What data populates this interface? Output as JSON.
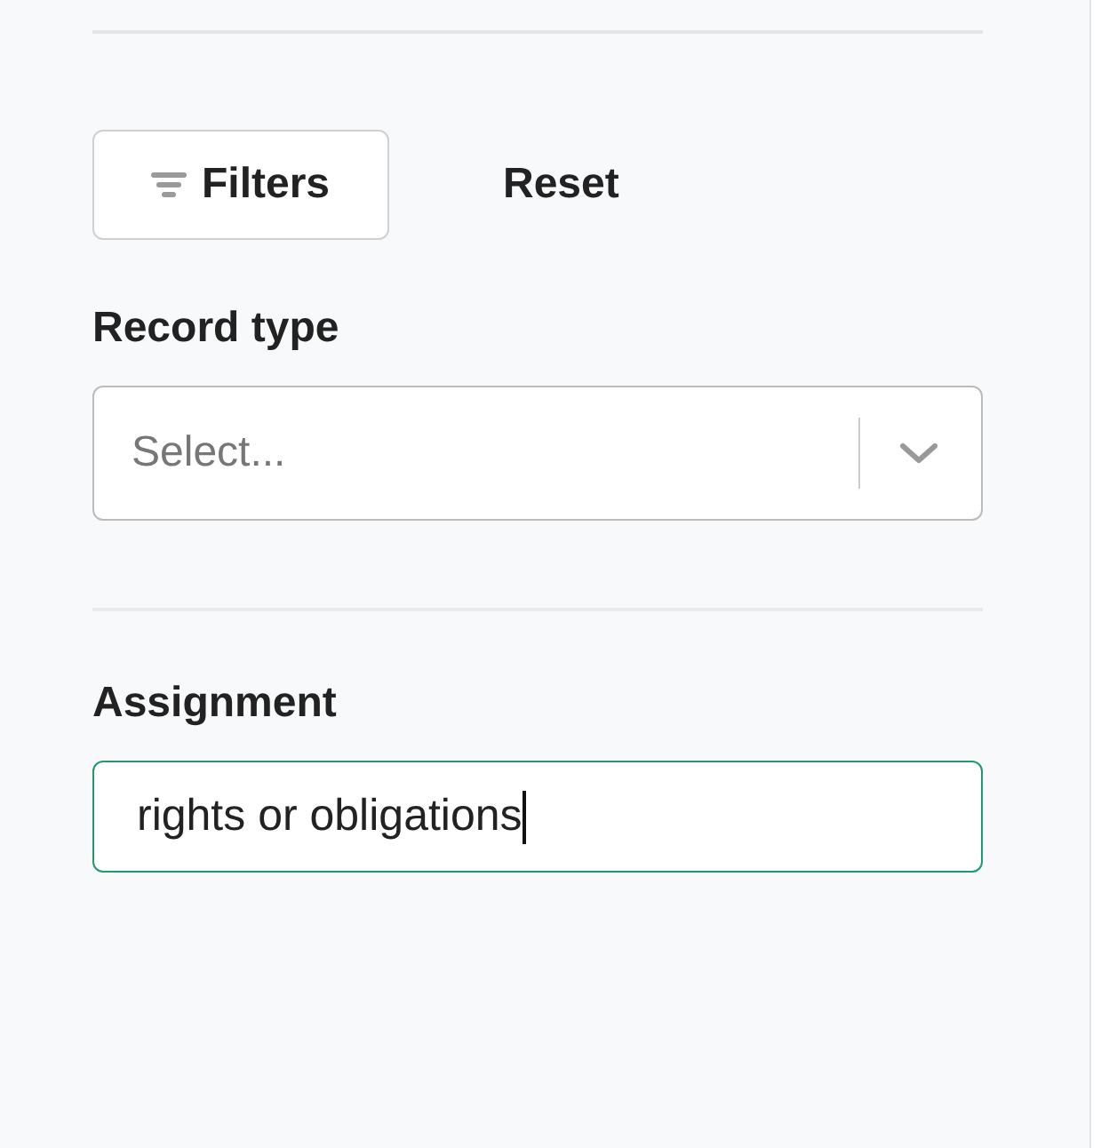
{
  "toolbar": {
    "filters_button": "Filters",
    "reset_button": "Reset"
  },
  "fields": [
    {
      "kind": "select",
      "label": "Record type",
      "placeholder": "Select...",
      "focused": false
    },
    {
      "kind": "text",
      "label": "Assignment",
      "value": "rights or obligations",
      "focused": true
    }
  ]
}
